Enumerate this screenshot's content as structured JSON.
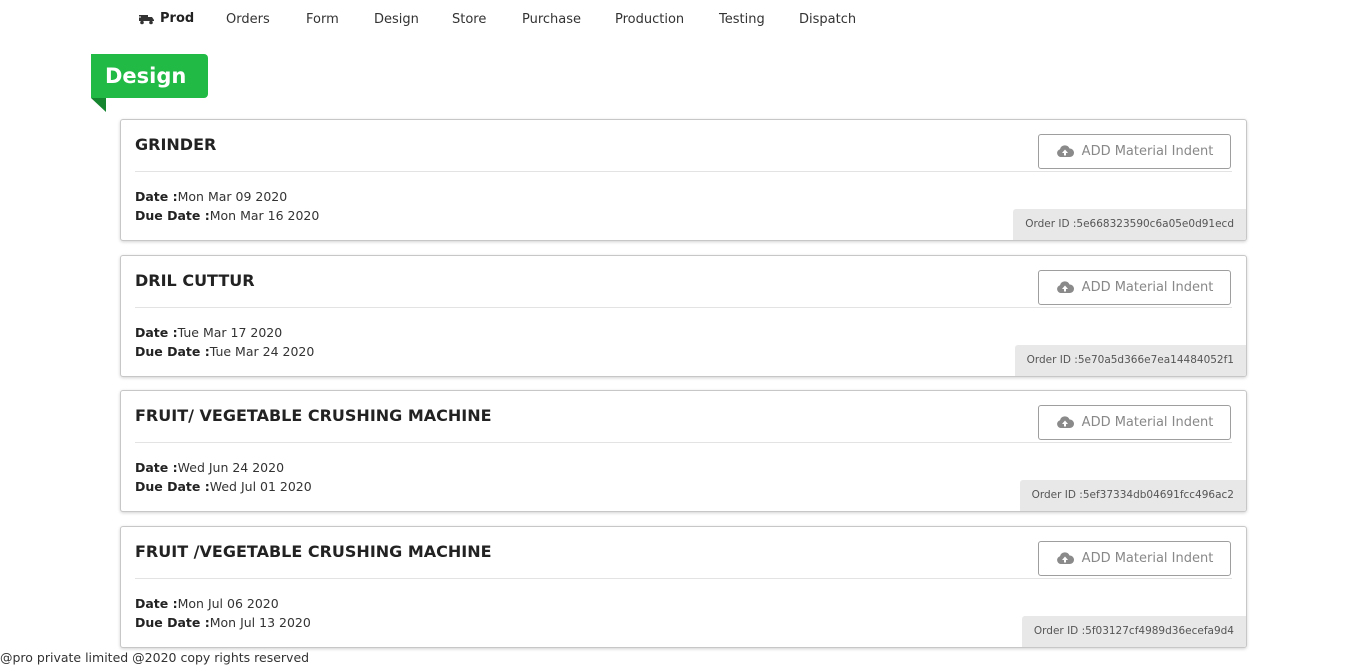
{
  "nav": {
    "brand": "Prod",
    "items": [
      "Orders",
      "Form",
      "Design",
      "Store",
      "Purchase",
      "Production",
      "Testing",
      "Dispatch"
    ]
  },
  "page": {
    "ribbon_title": "Design"
  },
  "labels": {
    "date": "Date :",
    "due_date": "Due Date :",
    "order_id": "Order ID :",
    "add_button": "ADD Material Indent"
  },
  "orders": [
    {
      "title": "GRINDER",
      "date": "Mon Mar 09 2020",
      "due_date": "Mon Mar 16 2020",
      "order_id": "5e668323590c6a05e0d91ecd"
    },
    {
      "title": "DRIL CUTTUR",
      "date": "Tue Mar 17 2020",
      "due_date": "Tue Mar 24 2020",
      "order_id": "5e70a5d366e7ea14484052f1"
    },
    {
      "title": "FRUIT/ VEGETABLE CRUSHING MACHINE",
      "date": "Wed Jun 24 2020",
      "due_date": "Wed Jul 01 2020",
      "order_id": "5ef37334db04691fcc496ac2"
    },
    {
      "title": "FRUIT /VEGETABLE CRUSHING MACHINE",
      "date": "Mon Jul 06 2020",
      "due_date": "Mon Jul 13 2020",
      "order_id": "5f03127cf4989d36ecefa9d4"
    }
  ],
  "footer": {
    "text": "@pro private limited @2020 copy rights reserved"
  },
  "colors": {
    "ribbon": "#21ba45",
    "ribbon_shadow": "#16852f",
    "order_id_bg": "#e8e8e8",
    "button_border": "#9e9e9e"
  },
  "icons": {
    "brand": "truck-icon",
    "add_button": "cloud-upload-icon"
  }
}
